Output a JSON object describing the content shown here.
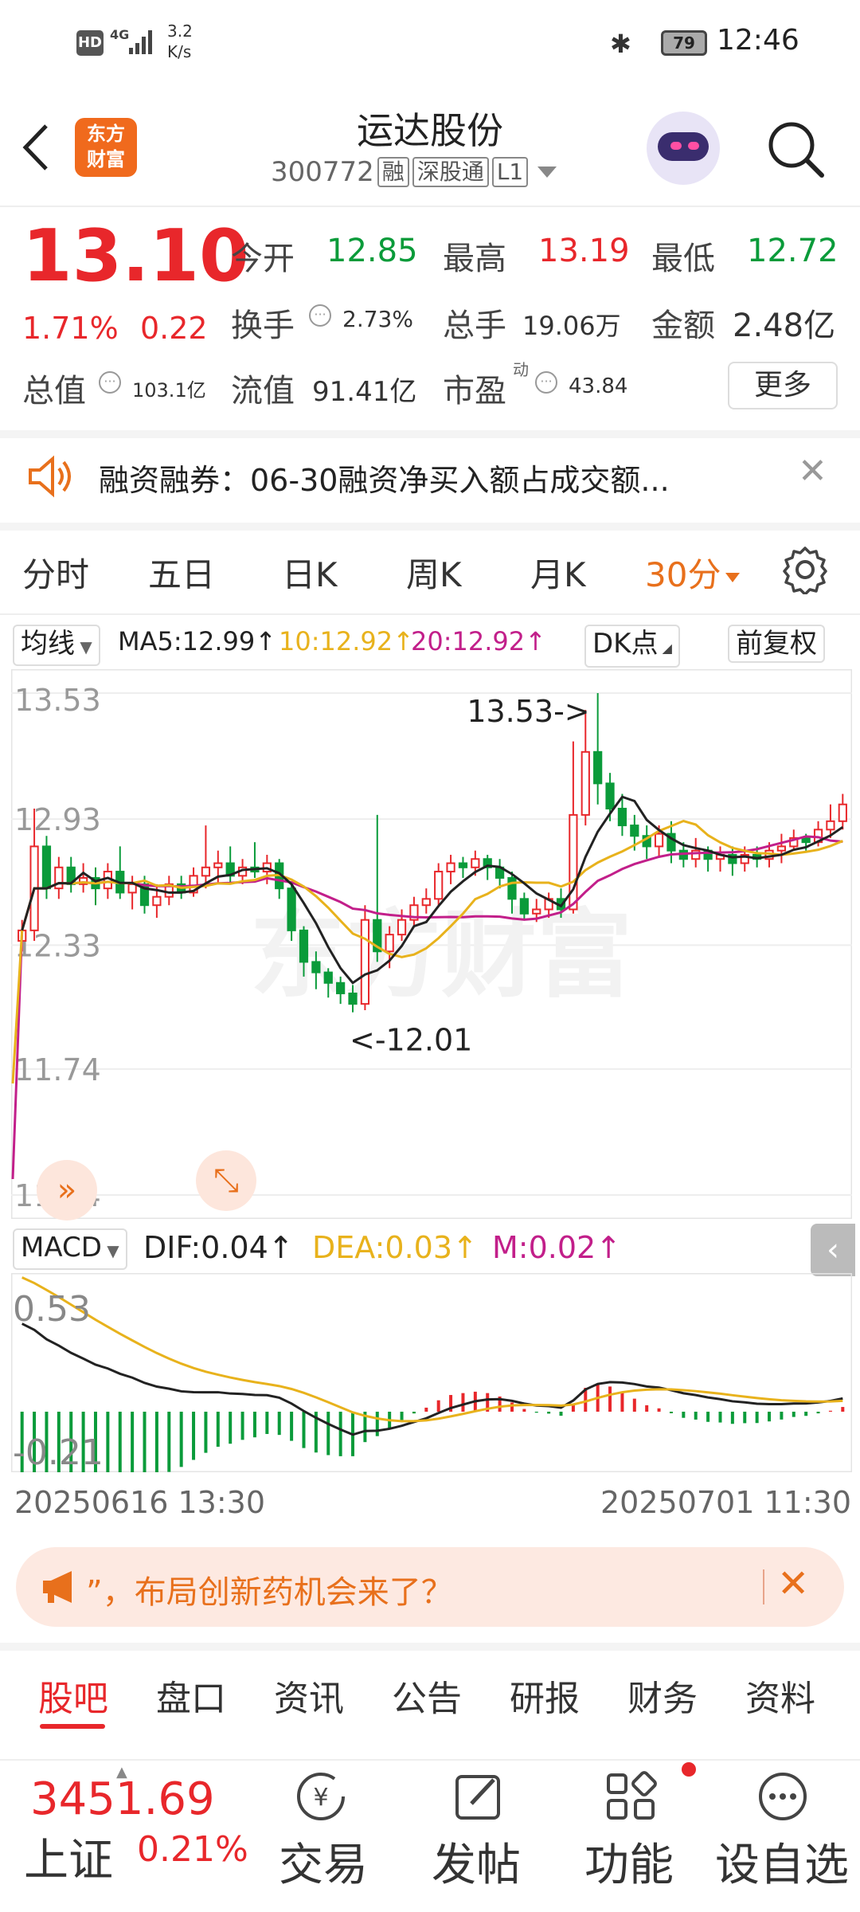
{
  "status_bar": {
    "hd": "HD",
    "network": "4G",
    "speed_value": "3.2",
    "speed_unit": "K/s",
    "battery": "79",
    "time": "12:46"
  },
  "header": {
    "logo_line1": "东方",
    "logo_line2": "财富",
    "stock_name": "运达股份",
    "stock_code": "300772",
    "tags": [
      "融",
      "深股通",
      "L1"
    ]
  },
  "quote": {
    "price": "13.10",
    "change_pct": "1.71%",
    "change": "0.22",
    "open_label": "今开",
    "open": "12.85",
    "high_label": "最高",
    "high": "13.19",
    "low_label": "最低",
    "low": "12.72",
    "turnover_label": "换手",
    "turnover": "2.73%",
    "volume_label": "总手",
    "volume": "19.06万",
    "amount_label": "金额",
    "amount": "2.48亿",
    "mcap_label": "总值",
    "mcap": "103.1亿",
    "float_label": "流值",
    "float": "91.41亿",
    "pe_label": "市盈",
    "pe_sup": "动",
    "pe": "43.84",
    "more_label": "更多"
  },
  "notice": {
    "text": "融资融券：06-30融资净买入额占成交额..."
  },
  "period_tabs": [
    "分时",
    "五日",
    "日K",
    "周K",
    "月K",
    "30分"
  ],
  "active_period": "30分",
  "indicators": {
    "main_select": "均线",
    "ma5": "MA5:12.99",
    "ma10": "10:12.92",
    "ma20": "20:12.92",
    "dk_label": "DK点",
    "adjust_label": "前复权",
    "macd_select": "MACD",
    "dif": "DIF:0.04",
    "dea": "DEA:0.03",
    "m": "M:0.02"
  },
  "chart_data": {
    "type": "candlestick",
    "y_axis_ticks": [
      "13.53",
      "12.93",
      "12.33",
      "11.74",
      "11.14"
    ],
    "ylim": [
      11.14,
      13.53
    ],
    "annotation_high": "13.53->",
    "annotation_low": "<-12.01",
    "macd_ticks": [
      "0.53",
      "-0.21"
    ],
    "x_start": "20250616 13:30",
    "x_end": "20250701 11:30",
    "ma_colors": {
      "ma5": "#222222",
      "ma10": "#e8b21c",
      "ma20": "#c21f8a"
    },
    "up_color": "#e8272b",
    "down_color": "#0a9b3a",
    "candles": [
      [
        12.35,
        12.4,
        12.45,
        12.3
      ],
      [
        12.4,
        12.8,
        12.98,
        12.35
      ],
      [
        12.8,
        12.6,
        12.85,
        12.55
      ],
      [
        12.6,
        12.7,
        12.75,
        12.55
      ],
      [
        12.7,
        12.62,
        12.75,
        12.58
      ],
      [
        12.62,
        12.65,
        12.72,
        12.58
      ],
      [
        12.65,
        12.6,
        12.7,
        12.52
      ],
      [
        12.6,
        12.68,
        12.72,
        12.55
      ],
      [
        12.68,
        12.58,
        12.8,
        12.55
      ],
      [
        12.58,
        12.62,
        12.66,
        12.5
      ],
      [
        12.62,
        12.52,
        12.66,
        12.48
      ],
      [
        12.52,
        12.56,
        12.62,
        12.46
      ],
      [
        12.56,
        12.62,
        12.66,
        12.52
      ],
      [
        12.62,
        12.58,
        12.66,
        12.55
      ],
      [
        12.58,
        12.66,
        12.7,
        12.56
      ],
      [
        12.66,
        12.7,
        12.9,
        12.6
      ],
      [
        12.7,
        12.72,
        12.78,
        12.62
      ],
      [
        12.72,
        12.66,
        12.8,
        12.62
      ],
      [
        12.66,
        12.7,
        12.74,
        12.62
      ],
      [
        12.7,
        12.68,
        12.82,
        12.65
      ],
      [
        12.68,
        12.72,
        12.76,
        12.62
      ],
      [
        12.72,
        12.6,
        12.74,
        12.55
      ],
      [
        12.6,
        12.4,
        12.62,
        12.35
      ],
      [
        12.4,
        12.25,
        12.42,
        12.18
      ],
      [
        12.25,
        12.2,
        12.3,
        12.12
      ],
      [
        12.2,
        12.15,
        12.22,
        12.08
      ],
      [
        12.15,
        12.1,
        12.18,
        12.05
      ],
      [
        12.1,
        12.05,
        12.14,
        12.01
      ],
      [
        12.05,
        12.45,
        12.52,
        12.02
      ],
      [
        12.45,
        12.3,
        12.95,
        12.25
      ],
      [
        12.3,
        12.38,
        12.42,
        12.22
      ],
      [
        12.38,
        12.45,
        12.5,
        12.35
      ],
      [
        12.45,
        12.52,
        12.56,
        12.42
      ],
      [
        12.52,
        12.55,
        12.6,
        12.48
      ],
      [
        12.55,
        12.68,
        12.72,
        12.52
      ],
      [
        12.68,
        12.72,
        12.76,
        12.62
      ],
      [
        12.72,
        12.7,
        12.75,
        12.65
      ],
      [
        12.7,
        12.74,
        12.78,
        12.66
      ],
      [
        12.74,
        12.7,
        12.76,
        12.64
      ],
      [
        12.7,
        12.65,
        12.74,
        12.6
      ],
      [
        12.65,
        12.55,
        12.68,
        12.48
      ],
      [
        12.55,
        12.48,
        12.58,
        12.45
      ],
      [
        12.48,
        12.5,
        12.55,
        12.44
      ],
      [
        12.5,
        12.55,
        12.58,
        12.46
      ],
      [
        12.55,
        12.5,
        12.6,
        12.46
      ],
      [
        12.5,
        12.95,
        13.3,
        12.48
      ],
      [
        12.95,
        13.25,
        13.45,
        12.9
      ],
      [
        13.25,
        13.1,
        13.53,
        13.0
      ],
      [
        13.1,
        12.98,
        13.15,
        12.92
      ],
      [
        12.98,
        12.9,
        13.05,
        12.85
      ],
      [
        12.9,
        12.85,
        12.95,
        12.78
      ],
      [
        12.85,
        12.8,
        12.9,
        12.74
      ],
      [
        12.8,
        12.86,
        12.9,
        12.75
      ],
      [
        12.86,
        12.78,
        12.92,
        12.72
      ],
      [
        12.78,
        12.74,
        12.82,
        12.7
      ],
      [
        12.74,
        12.78,
        12.84,
        12.7
      ],
      [
        12.78,
        12.74,
        12.8,
        12.68
      ],
      [
        12.74,
        12.76,
        12.8,
        12.68
      ],
      [
        12.76,
        12.72,
        12.8,
        12.66
      ],
      [
        12.72,
        12.76,
        12.8,
        12.68
      ],
      [
        12.76,
        12.74,
        12.8,
        12.7
      ],
      [
        12.74,
        12.78,
        12.82,
        12.7
      ],
      [
        12.78,
        12.8,
        12.86,
        12.72
      ],
      [
        12.8,
        12.84,
        12.88,
        12.78
      ],
      [
        12.84,
        12.82,
        12.86,
        12.78
      ],
      [
        12.82,
        12.88,
        12.92,
        12.8
      ],
      [
        12.88,
        12.92,
        13.0,
        12.84
      ],
      [
        12.92,
        13.0,
        13.05,
        12.88
      ]
    ]
  },
  "promo": {
    "text": "”，布局创新药机会来了？"
  },
  "bottom_tabs": [
    "股吧",
    "盘口",
    "资讯",
    "公告",
    "研报",
    "财务",
    "资料"
  ],
  "active_bottom_tab": "股吧",
  "index": {
    "value": "3451.69",
    "name": "上证",
    "pct": "0.21%"
  },
  "nav": [
    "交易",
    "发帖",
    "功能",
    "设自选"
  ]
}
